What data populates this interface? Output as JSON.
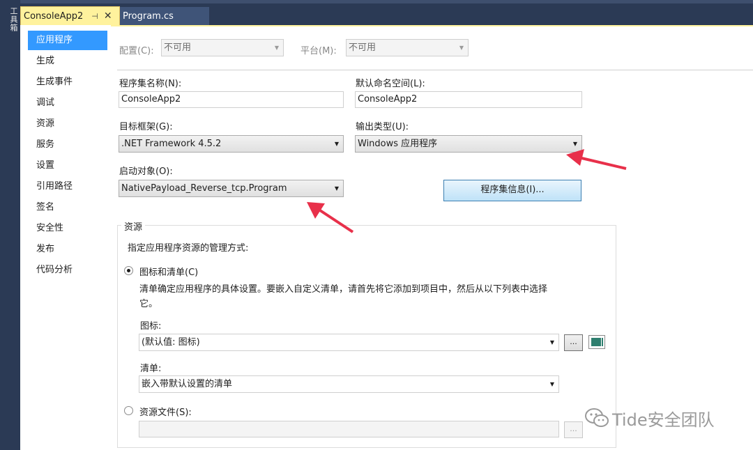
{
  "toolbox": {
    "label": "工具箱"
  },
  "tabs": [
    {
      "label": "ConsoleApp2",
      "pin": "⊣",
      "close": "✕"
    },
    {
      "label": "Program.cs"
    }
  ],
  "nav": {
    "items": [
      "应用程序",
      "生成",
      "生成事件",
      "调试",
      "资源",
      "服务",
      "设置",
      "引用路径",
      "签名",
      "安全性",
      "发布",
      "代码分析"
    ]
  },
  "config": {
    "config_label": "配置(C):",
    "config_value": "不可用",
    "platform_label": "平台(M):",
    "platform_value": "不可用"
  },
  "form": {
    "assembly_name_label": "程序集名称(N):",
    "assembly_name_value": "ConsoleApp2",
    "default_namespace_label": "默认命名空间(L):",
    "default_namespace_value": "ConsoleApp2",
    "target_framework_label": "目标框架(G):",
    "target_framework_value": ".NET Framework 4.5.2",
    "output_type_label": "输出类型(U):",
    "output_type_value": "Windows 应用程序",
    "startup_object_label": "启动对象(O):",
    "startup_object_value": "NativePayload_Reverse_tcp.Program",
    "assembly_info_button": "程序集信息(I)..."
  },
  "resources": {
    "group_title": "资源",
    "description": "指定应用程序资源的管理方式:",
    "icon_manifest_option": "图标和清单(C)",
    "icon_manifest_help_line1": "清单确定应用程序的具体设置。要嵌入自定义清单，请首先将它添加到项目中，然后从以下列表中选择",
    "icon_manifest_help_line2": "它。",
    "icon_label": "图标:",
    "icon_value": "(默认值: 图标)",
    "browse_label": "...",
    "manifest_label": "清单:",
    "manifest_value": "嵌入带默认设置的清单",
    "resource_file_option": "资源文件(S):"
  },
  "watermark": {
    "text": "Tide安全团队"
  },
  "colors": {
    "accent": "#3399ff",
    "tab_active": "#fff29d",
    "chrome": "#2b3a55",
    "arrow": "#e8304a"
  }
}
